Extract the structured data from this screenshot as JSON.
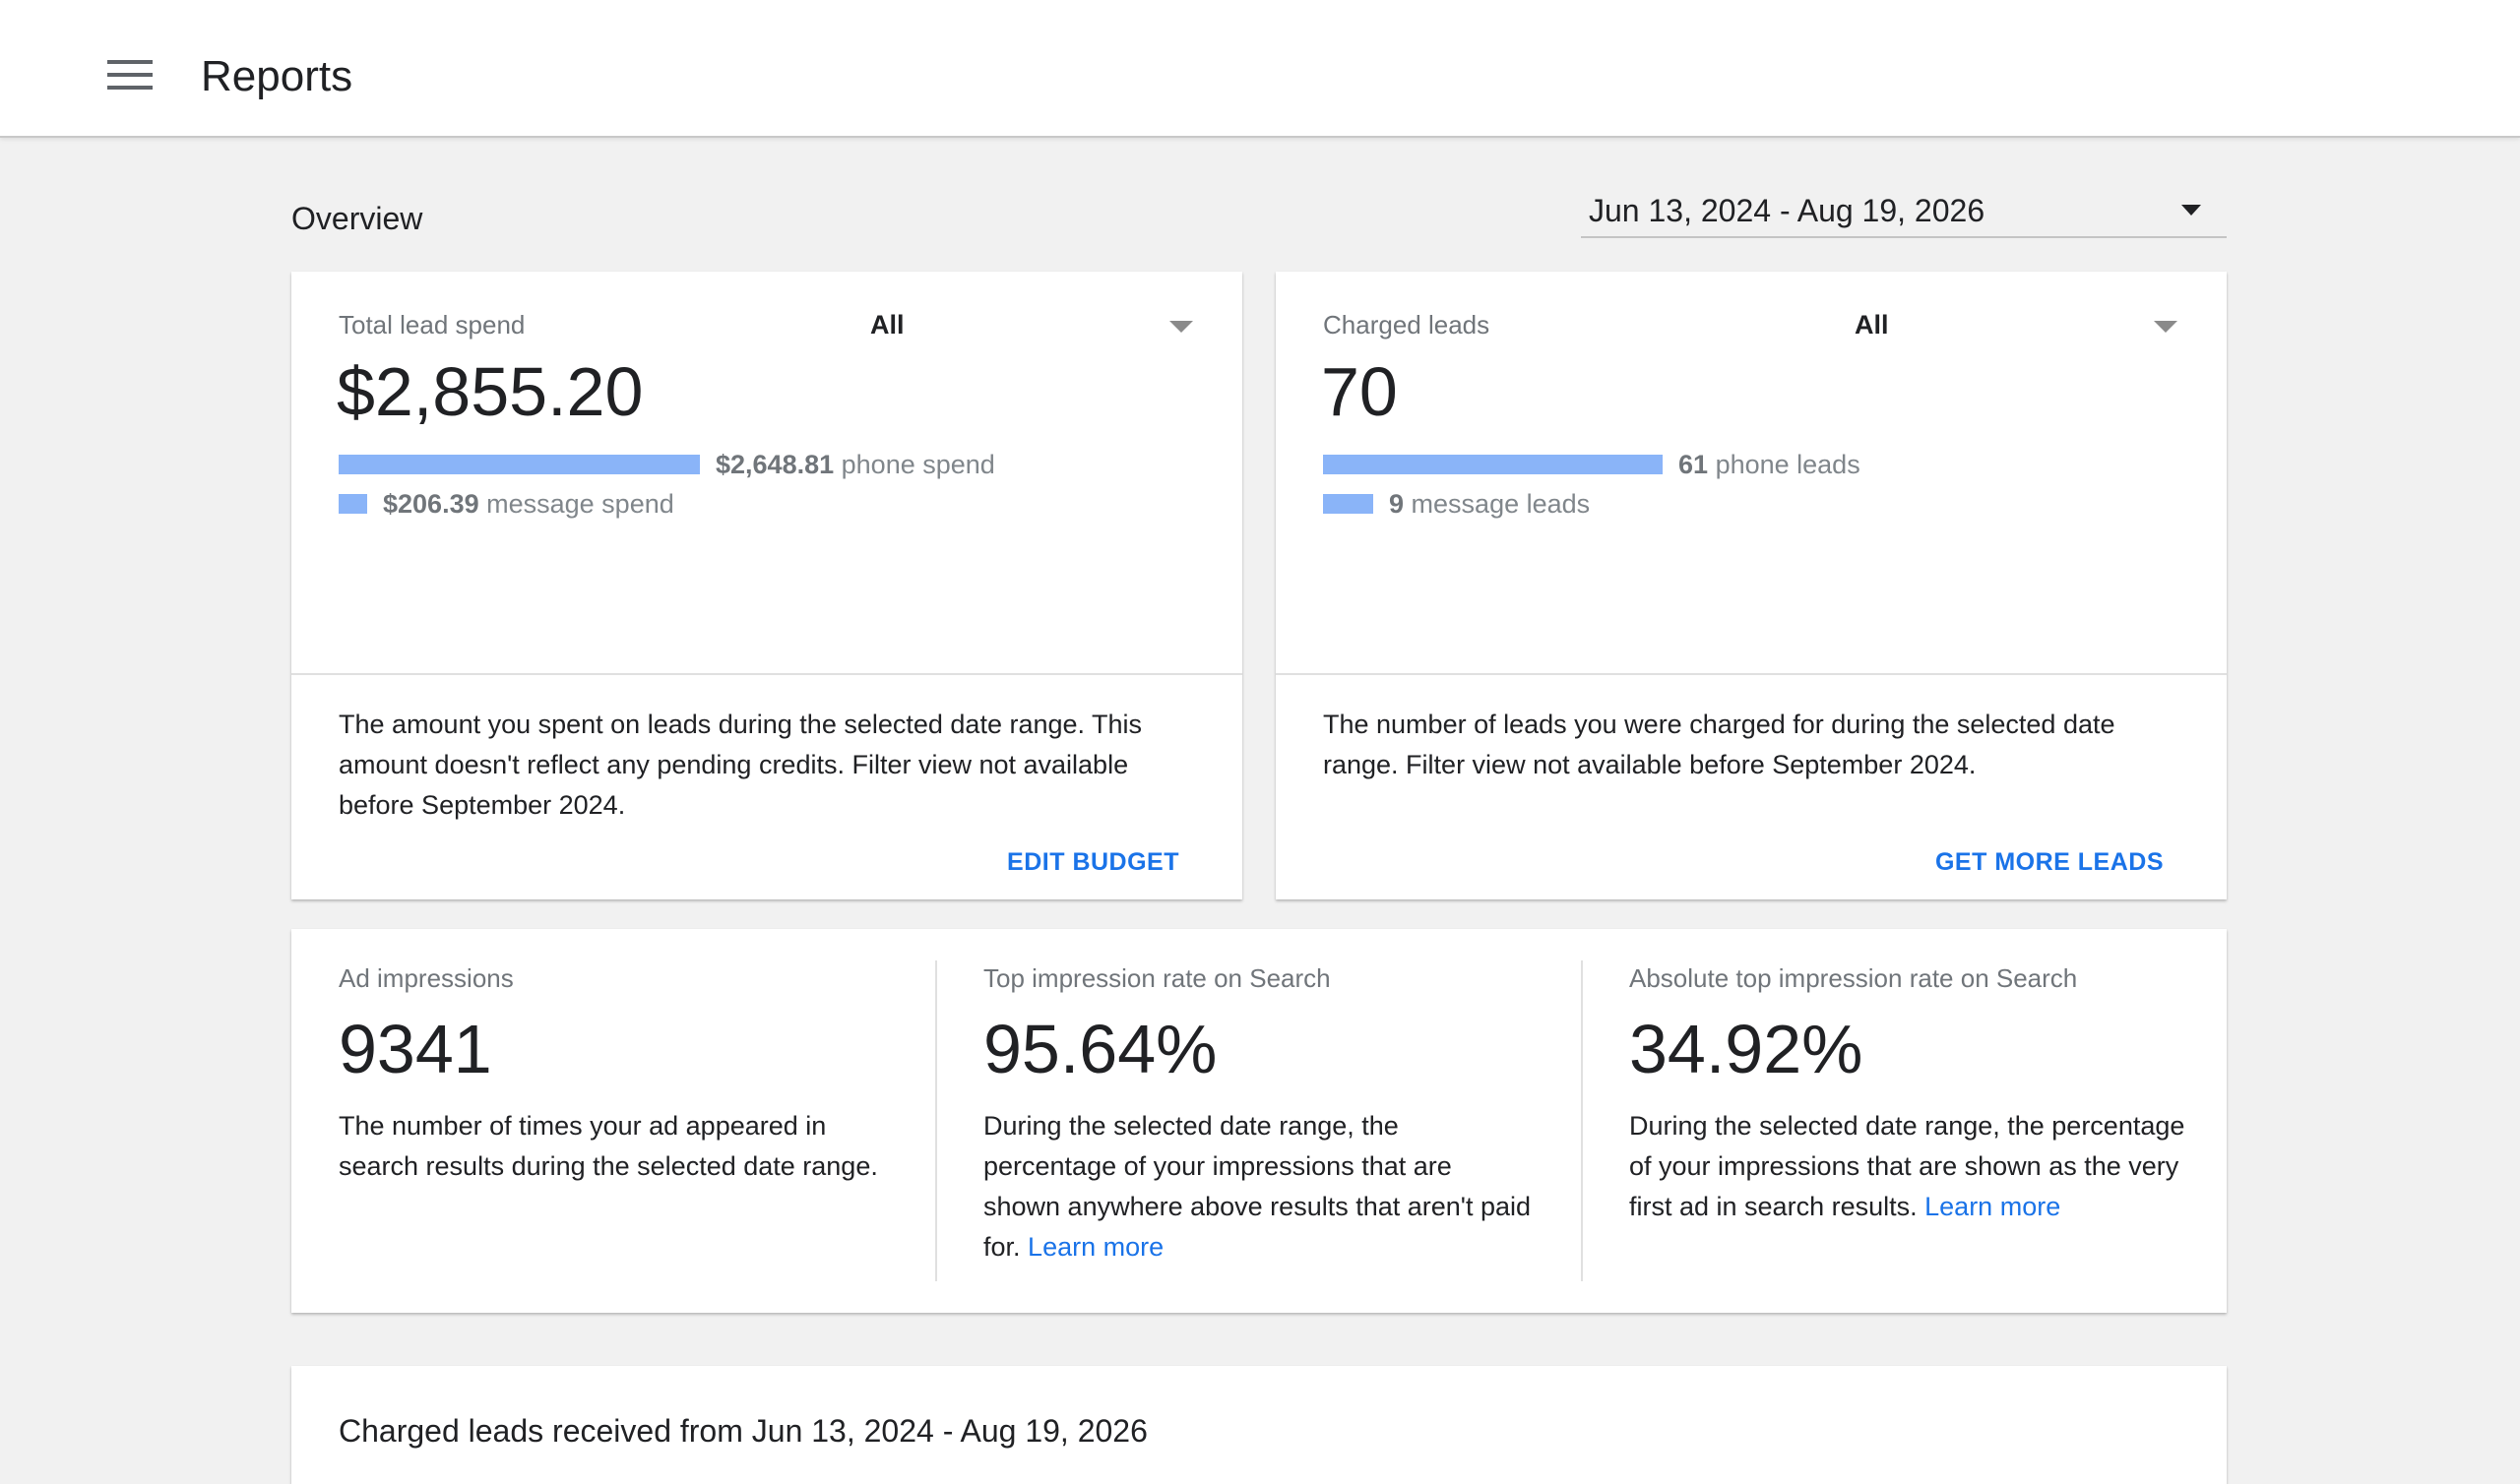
{
  "header": {
    "title": "Reports",
    "menu_icon": "hamburger-menu-icon"
  },
  "overview": {
    "label": "Overview",
    "date_range": "Jun 13, 2024 - Aug 19, 2026"
  },
  "lead_spend_card": {
    "label": "Total lead spend",
    "filter": "All",
    "total": "$2,855.20",
    "phone_amount": "$2,648.81",
    "phone_label": "phone spend",
    "phone_fraction": 0.9277,
    "message_amount": "$206.39",
    "message_label": "message spend",
    "message_fraction": 0.0723,
    "description": "The amount you spent on leads during the selected date range. This amount doesn't reflect any pending credits. Filter view not available before September 2024.",
    "action": "EDIT BUDGET"
  },
  "charged_leads_card": {
    "label": "Charged leads",
    "filter": "All",
    "total": "70",
    "phone_count": "61",
    "phone_label": "phone leads",
    "phone_fraction": 0.8714,
    "message_count": "9",
    "message_label": "message leads",
    "message_fraction": 0.1286,
    "description": "The number of leads you were charged for during the selected date range. Filter view not available before September 2024.",
    "action": "GET MORE LEADS"
  },
  "stats": [
    {
      "label": "Ad impressions",
      "value": "9341",
      "description": "The number of times your ad appeared in search results during the selected date range.",
      "link": ""
    },
    {
      "label": "Top impression rate on Search",
      "value": "95.64%",
      "description": "During the selected date range, the percentage of your impressions that are shown anywhere above results that aren't paid for.",
      "link": "Learn more"
    },
    {
      "label": "Absolute top impression rate on Search",
      "value": "34.92%",
      "description": "During the selected date range, the percentage of your impressions that are shown as the very first ad in search results.",
      "link": "Learn more"
    }
  ],
  "charged_leads_section": {
    "title": "Charged leads received from Jun 13, 2024 - Aug 19, 2026"
  },
  "colors": {
    "bar": "#8ab4f8",
    "link": "#1a73e8",
    "background": "#f1f1f1"
  }
}
